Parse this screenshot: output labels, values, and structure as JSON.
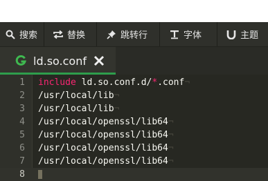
{
  "toolbar": {
    "items": [
      {
        "label": "搜索",
        "icon": "search-icon"
      },
      {
        "label": "替换",
        "icon": "replace-icon"
      },
      {
        "label": "跳转行",
        "icon": "pin-icon"
      },
      {
        "label": "字体",
        "icon": "text-format-icon"
      },
      {
        "label": "主题",
        "icon": "theme-icon"
      }
    ]
  },
  "tab": {
    "title": "ld.so.conf",
    "icon": "g-file-icon",
    "close_icon": "close-icon",
    "accent": "#2e9e4c"
  },
  "editor": {
    "lines": [
      {
        "num": "1",
        "keyword": "include",
        "before_op": " ld.so.conf.d/",
        "op": "*",
        "after_op": ".conf",
        "eol": "¬"
      },
      {
        "num": "2",
        "text": "/usr/local/lib",
        "eol": "¬"
      },
      {
        "num": "3",
        "text": "/usr/local/lib",
        "eol": "¬"
      },
      {
        "num": "4",
        "text": "/usr/local/openssl/lib64",
        "eol": "¬"
      },
      {
        "num": "5",
        "text": "/usr/local/openssl/lib64",
        "eol": "¬"
      },
      {
        "num": "6",
        "text": "/usr/local/openssl/lib64",
        "eol": "¬"
      },
      {
        "num": "7",
        "text": "/usr/local/openssl/lib64",
        "eol": "¬"
      },
      {
        "num": "8",
        "text": ""
      }
    ]
  },
  "colors": {
    "editor_bg": "#272822",
    "keyword": "#f92672",
    "text": "#f8f8f2",
    "line_number": "#8f908a",
    "toolbar_bg": "#2f302b"
  }
}
